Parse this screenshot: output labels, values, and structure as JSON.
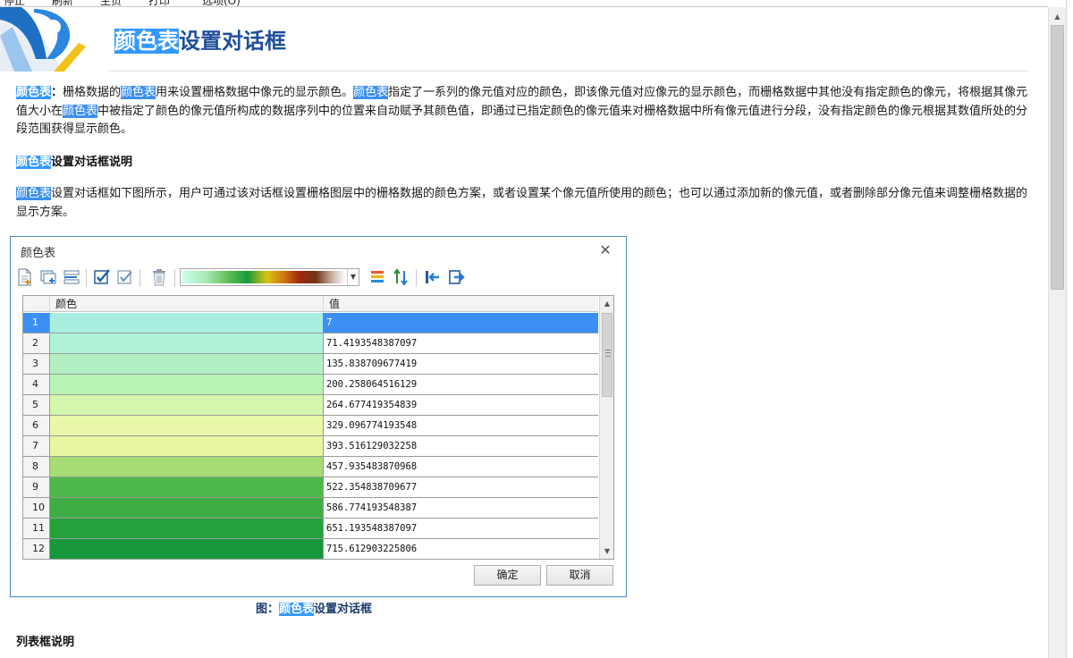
{
  "top_menu": [
    "停止",
    "刷新",
    "主页",
    "打印",
    "选项(O)"
  ],
  "header": {
    "title_highlight": "颜色表",
    "title_rest": "设置对话框"
  },
  "intro": {
    "term": "颜色表",
    "colon": "：",
    "t1": "栅格数据的",
    "term2": "颜色表",
    "t2": "用来设置栅格数据中像元的显示颜色。",
    "term3": "颜色表",
    "t3": "指定了一系列的像元值对应的颜色，即该像元值对应像元的显示颜色，而栅格数据中其他没有指定颜色的像元，将根据其像元值大小在",
    "term4": "颜色表",
    "t4": "中被指定了颜色的像元值所构成的数据序列中的位置来自动赋予其颜色值，即通过已指定颜色的像元值来对栅格数据中所有像元值进行分段，没有指定颜色的像元根据其数值所处的分段范围获得显示颜色。"
  },
  "section1": {
    "heading_highlight": "颜色表",
    "heading_rest": "设置对话框说明",
    "para_highlight": "颜色表",
    "para_rest": "设置对话框如下图所示，用户可通过该对话框设置栅格图层中的栅格数据的颜色方案，或者设置某个像元值所使用的颜色；也可以通过添加新的像元值，或者删除部分像元值来调整栅格数据的显示方案。"
  },
  "dialog": {
    "title": "颜色表",
    "close_glyph": "✕",
    "columns": {
      "color": "颜色",
      "value": "值"
    },
    "ok_label": "确定",
    "cancel_label": "取消",
    "selected_row": 1,
    "rows": [
      {
        "num": "1",
        "color": "#a8efe0",
        "value": "7"
      },
      {
        "num": "2",
        "color": "#b0f2d8",
        "value": "71.4193548387097"
      },
      {
        "num": "3",
        "color": "#b2f0c4",
        "value": "135.838709677419"
      },
      {
        "num": "4",
        "color": "#b8f4b4",
        "value": "200.258064516129"
      },
      {
        "num": "5",
        "color": "#d4f6ac",
        "value": "264.677419354839"
      },
      {
        "num": "6",
        "color": "#e8f8a8",
        "value": "329.096774193548"
      },
      {
        "num": "7",
        "color": "#e8f6a0",
        "value": "393.516129032258"
      },
      {
        "num": "8",
        "color": "#a6dc74",
        "value": "457.935483870968"
      },
      {
        "num": "9",
        "color": "#4db84a",
        "value": "522.354838709677"
      },
      {
        "num": "10",
        "color": "#3eae44",
        "value": "586.774193548387"
      },
      {
        "num": "11",
        "color": "#24a23c",
        "value": "651.193548387097"
      },
      {
        "num": "12",
        "color": "#16983a",
        "value": "715.612903225806"
      }
    ]
  },
  "figure_caption": {
    "prefix": "图：",
    "highlight": "颜色表",
    "rest": "设置对话框"
  },
  "section2": {
    "heading": "列表框说明"
  }
}
